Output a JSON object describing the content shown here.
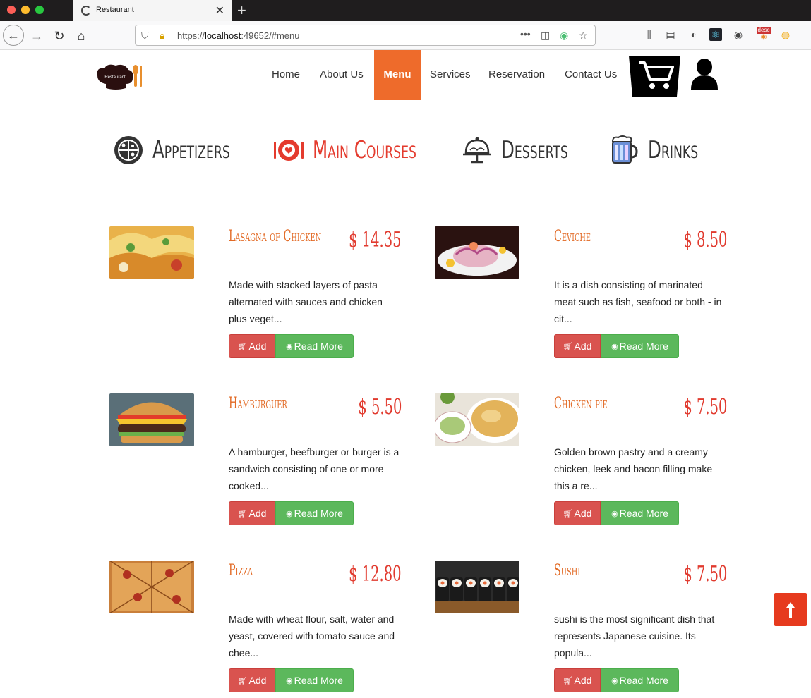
{
  "browser": {
    "tab_title": "Restaurant",
    "url_prefix": "https://",
    "url_host": "localhost",
    "url_rest": ":49652/#menu",
    "extension_badge": "desc"
  },
  "site": {
    "logo_text": "Restaurant",
    "nav": [
      "Home",
      "About Us",
      "Menu",
      "Services",
      "Reservation",
      "Contact Us"
    ],
    "active_nav": "Menu"
  },
  "categories": [
    {
      "label": "Appetizers",
      "icon": "pizza-icon"
    },
    {
      "label": "Main Courses",
      "icon": "plate-cutlery-icon"
    },
    {
      "label": "Desserts",
      "icon": "cake-stand-icon"
    },
    {
      "label": "Drinks",
      "icon": "beer-mug-icon"
    }
  ],
  "items": [
    {
      "name": "Lasagna of Chicken",
      "price": "$ 14.35",
      "desc": "Made with stacked layers of pasta alternated with sauces and chicken plus veget...",
      "image": "lasagna"
    },
    {
      "name": "Ceviche",
      "price": "$ 8.50",
      "desc": "It is a dish consisting of marinated meat such as fish, seafood or both - in cit...",
      "image": "ceviche"
    },
    {
      "name": "Hamburguer",
      "price": "$ 5.50",
      "desc": "A hamburger, beefburger or burger is a sandwich consisting of one or more cooked...",
      "image": "hamburger"
    },
    {
      "name": "Chicken pie",
      "price": "$ 7.50",
      "desc": "Golden brown pastry and a creamy chicken, leek and bacon filling make this a re...",
      "image": "chicken-pie"
    },
    {
      "name": "Pizza",
      "price": "$ 12.80",
      "desc": "Made with wheat flour, salt, water and yeast, covered with tomato sauce and chee...",
      "image": "pizza"
    },
    {
      "name": "Sushi",
      "price": "$ 7.50",
      "desc": "sushi is the most significant dish that represents Japanese cuisine. Its popula...",
      "image": "sushi"
    }
  ],
  "buttons": {
    "add": "Add",
    "read_more": "Read More"
  },
  "colors": {
    "accent": "#ee6b2b",
    "price": "#e13a2e",
    "add": "#d9534f",
    "more": "#5cb85c",
    "to_top": "#e63a1e"
  }
}
